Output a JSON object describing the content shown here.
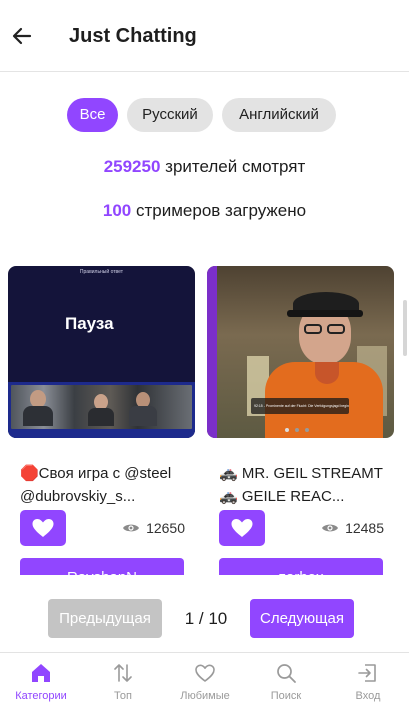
{
  "header": {
    "title": "Just Chatting"
  },
  "filters": [
    "Все",
    "Русский",
    "Английский"
  ],
  "stats": {
    "viewers_count": "259250",
    "viewers_text": "зрителей смотрят",
    "streamers_count": "100",
    "streamers_text": "стримеров загружено"
  },
  "cards": [
    {
      "thumb_header": "Правильный ответ",
      "thumb_text": "Пауза",
      "title_line1": "🛑Своя игра с @steel",
      "title_line2": "@dubrovskiy_s...",
      "viewers": "12650",
      "user": "RavshanN"
    },
    {
      "thumb_caption": "92:15 - Prominente auf der Flucht: Die Verfolgungsjagd beginnt!",
      "title_line1": "🚓 MR. GEIL STREAMT",
      "title_line2": "🚓 GEILE REAC...",
      "viewers": "12485",
      "user": "zarbex"
    }
  ],
  "pagination": {
    "prev": "Предыдущая",
    "page": "1 / 10",
    "next": "Следующая"
  },
  "tabs": [
    "Категории",
    "Топ",
    "Любимые",
    "Поиск",
    "Вход"
  ],
  "colors": {
    "accent": "#9146ff",
    "disabled": "#c4c4c4",
    "chip": "#e3e3e3"
  }
}
